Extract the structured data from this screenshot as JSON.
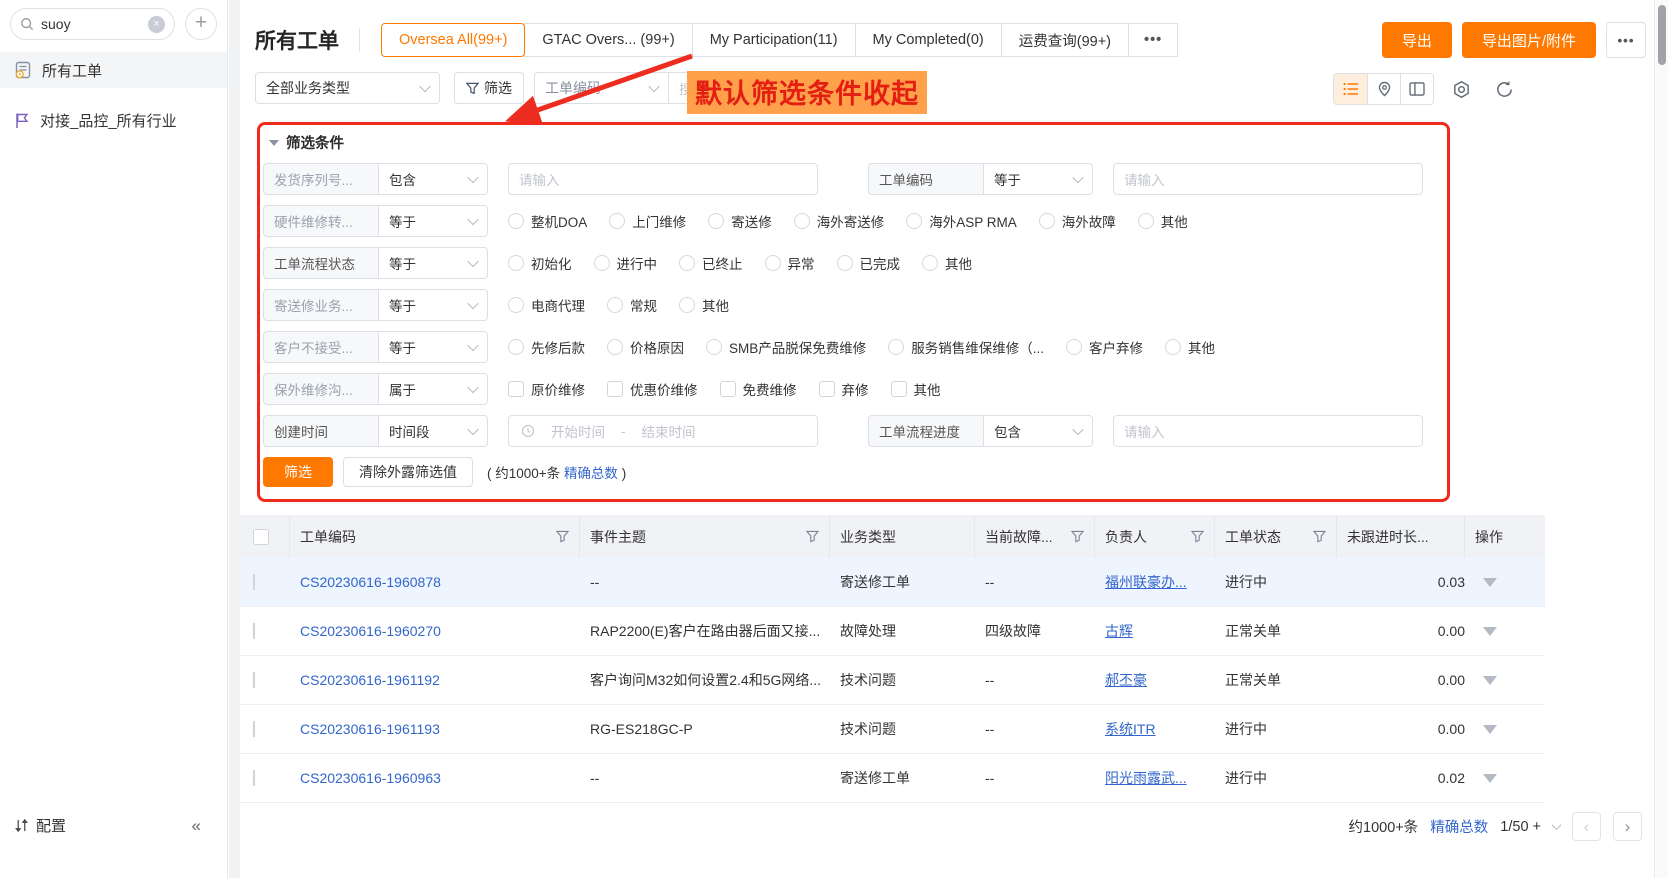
{
  "colors": {
    "accent": "#ff7800",
    "link": "#3366cc",
    "annotation_red": "#e21f12",
    "annotation_highlight": "#ffa14b"
  },
  "sidebar": {
    "search": {
      "value": "suoy",
      "clear_icon": "×",
      "add_icon": "+"
    },
    "items": [
      {
        "label": "所有工单",
        "active": true
      },
      {
        "label": "对接_品控_所有行业",
        "active": false
      }
    ],
    "footer": {
      "config_label": "配置",
      "collapse_icon": "«"
    }
  },
  "header": {
    "title": "所有工单",
    "tabs": [
      {
        "label": "Oversea All(99+)",
        "active": true
      },
      {
        "label": "GTAC Overs... (99+)",
        "active": false
      },
      {
        "label": "My Participation(11)",
        "active": false
      },
      {
        "label": "My Completed(0)",
        "active": false
      },
      {
        "label": "运费查询(99+)",
        "active": false
      },
      {
        "label": "•••",
        "active": false,
        "more": true
      }
    ],
    "actions": {
      "export_label": "导出",
      "export_attachments_label": "导出图片/附件",
      "more_label": "•••"
    }
  },
  "toolbar": {
    "business_type_value": "全部业务类型",
    "filter_button_label": "筛选",
    "search_field_value": "工单编码",
    "search_placeholder": "搜索工单编码"
  },
  "annotation": {
    "text": "默认筛选条件收起"
  },
  "filter_panel": {
    "title": "筛选条件",
    "rows": [
      {
        "groups": [
          {
            "label": "发货序列号...",
            "muted": true,
            "op": "包含",
            "control": {
              "kind": "input",
              "placeholder": "请输入"
            }
          },
          {
            "label": "工单编码",
            "muted": false,
            "op": "等于",
            "control": {
              "kind": "input",
              "placeholder": "请输入"
            }
          }
        ]
      },
      {
        "groups": [
          {
            "label": "硬件维修转...",
            "muted": true,
            "op": "等于",
            "control": {
              "kind": "radios",
              "options": [
                "整机DOA",
                "上门维修",
                "寄送修",
                "海外寄送修",
                "海外ASP RMA",
                "海外故障",
                "其他"
              ]
            }
          }
        ]
      },
      {
        "groups": [
          {
            "label": "工单流程状态",
            "muted": false,
            "op": "等于",
            "control": {
              "kind": "radios",
              "options": [
                "初始化",
                "进行中",
                "已终止",
                "异常",
                "已完成",
                "其他"
              ]
            }
          }
        ]
      },
      {
        "groups": [
          {
            "label": "寄送修业务...",
            "muted": true,
            "op": "等于",
            "control": {
              "kind": "radios",
              "options": [
                "电商代理",
                "常规",
                "其他"
              ]
            }
          }
        ]
      },
      {
        "groups": [
          {
            "label": "客户不接受...",
            "muted": true,
            "op": "等于",
            "control": {
              "kind": "radios",
              "options": [
                "先修后款",
                "价格原因",
                "SMB产品脱保免费维修",
                "服务销售维保维修（...",
                "客户弃修",
                "其他"
              ]
            }
          }
        ]
      },
      {
        "groups": [
          {
            "label": "保外维修沟...",
            "muted": true,
            "op": "属于",
            "control": {
              "kind": "checks",
              "options": [
                "原价维修",
                "优惠价维修",
                "免费维修",
                "弃修",
                "其他"
              ]
            }
          }
        ]
      },
      {
        "groups": [
          {
            "label": "创建时间",
            "muted": false,
            "op": "时间段",
            "control": {
              "kind": "daterange",
              "start": "开始时间",
              "separator": "-",
              "end": "结束时间"
            }
          },
          {
            "label": "工单流程进度",
            "muted": false,
            "op": "包含",
            "control": {
              "kind": "input",
              "placeholder": "请输入"
            }
          }
        ]
      }
    ],
    "submit_label": "筛选",
    "clear_label": "清除外露筛选值",
    "count_prefix": "( 约1000+条",
    "count_link": "精确总数",
    "count_suffix": ")"
  },
  "table": {
    "columns": [
      {
        "key": "select",
        "type": "checkbox",
        "label": ""
      },
      {
        "key": "id",
        "label": "工单编码",
        "filter": true
      },
      {
        "key": "subject",
        "label": "事件主题",
        "filter": true
      },
      {
        "key": "type",
        "label": "业务类型",
        "filter": false
      },
      {
        "key": "fault",
        "label": "当前故障...",
        "filter": true
      },
      {
        "key": "owner",
        "label": "负责人",
        "filter": true
      },
      {
        "key": "status",
        "label": "工单状态",
        "filter": true
      },
      {
        "key": "duration",
        "label": "未跟进时长...",
        "filter": false
      },
      {
        "key": "action",
        "label": "操作",
        "filter": false
      }
    ],
    "rows": [
      {
        "id": "CS20230616-1960878",
        "subject": "--",
        "type": "寄送修工单",
        "fault": "--",
        "owner": "福州联豪办...",
        "status": "进行中",
        "duration": "0.03",
        "highlighted": true
      },
      {
        "id": "CS20230616-1960270",
        "subject": "RAP2200(E)客户在路由器后面又接...",
        "type": "故障处理",
        "fault": "四级故障",
        "owner": "古辉",
        "status": "正常关单",
        "duration": "0.00",
        "highlighted": false
      },
      {
        "id": "CS20230616-1961192",
        "subject": "客户询问M32如何设置2.4和5G网络...",
        "type": "技术问题",
        "fault": "--",
        "owner": "郝丕豪",
        "status": "正常关单",
        "duration": "0.00",
        "highlighted": false
      },
      {
        "id": "CS20230616-1961193",
        "subject": "RG-ES218GC-P",
        "type": "技术问题",
        "fault": "--",
        "owner": "系统ITR",
        "status": "进行中",
        "duration": "0.00",
        "highlighted": false
      },
      {
        "id": "CS20230616-1960963",
        "subject": "--",
        "type": "寄送修工单",
        "fault": "--",
        "owner": "阳光雨露武...",
        "status": "进行中",
        "duration": "0.02",
        "highlighted": false
      }
    ]
  },
  "pagination": {
    "total": "约1000+条",
    "exact_link": "精确总数",
    "page": "1/50 +",
    "prev_icon": "‹",
    "next_icon": "›"
  }
}
